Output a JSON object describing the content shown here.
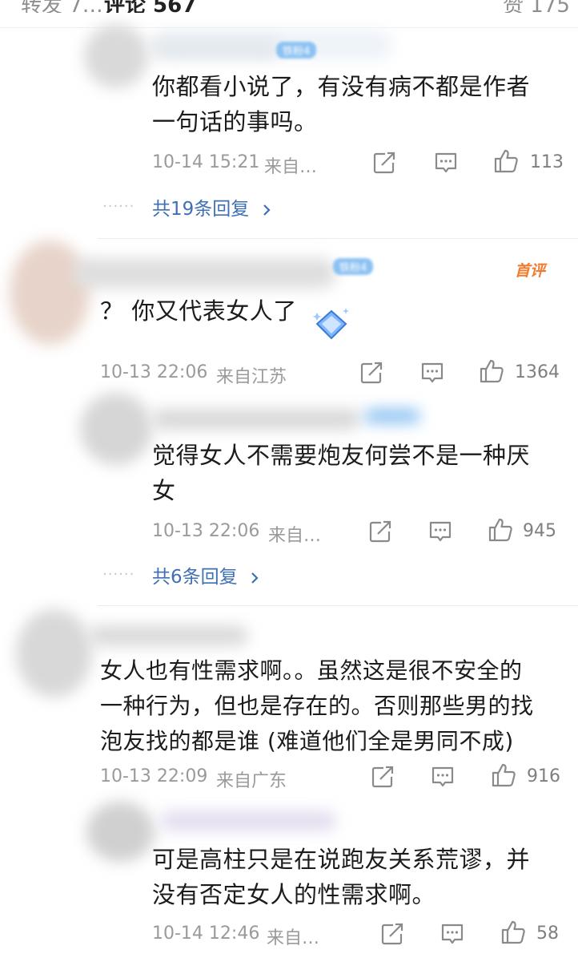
{
  "header": {
    "tab_left": "转发 7…",
    "tab_active": "评论 567",
    "tab_right": "赞 175"
  },
  "comments": [
    {
      "level_badge": "铁粉4",
      "text_lines": [
        "你都看小说了，有没有病不都是作者",
        "一句话的事吗。"
      ],
      "time": "10-14 15:21",
      "location": "来自…",
      "likes": "113",
      "replies_label": "共19条回复",
      "replies_dots": "······"
    },
    {
      "level_badge": "铁粉4",
      "first_badge": "首评",
      "text_lines": [
        "？ 你又代表女人了"
      ],
      "sticker": "diamond-sticker",
      "time": "10-13 22:06",
      "location": "来自江苏",
      "likes": "1364"
    },
    {
      "text_lines": [
        "觉得女人不需要炮友何尝不是一种厌",
        "女"
      ],
      "time": "10-13 22:06",
      "location": "来自…",
      "likes": "945",
      "replies_label": "共6条回复",
      "replies_dots": "······"
    },
    {
      "text_lines": [
        "女人也有性需求啊。。虽然这是很不安全的",
        "一种行为，但也是存在的。否则那些男的找",
        "泡友找的都是谁 (难道他们全是男同不成)"
      ],
      "time": "10-13 22:09",
      "location": "来自广东",
      "likes": "916"
    },
    {
      "text_lines": [
        "可是高柱只是在说跑友关系荒谬，并",
        "没有否定女人的性需求啊。"
      ],
      "time": "10-14 12:46",
      "location": "来自…",
      "likes": "58"
    }
  ],
  "icons": {
    "share": "share-icon",
    "comment": "comment-icon",
    "like": "thumbs-up-icon"
  },
  "colors": {
    "link_blue": "#3f6fb5",
    "meta_gray": "#9a9a9a",
    "first_badge_orange": "#f07c2f"
  }
}
